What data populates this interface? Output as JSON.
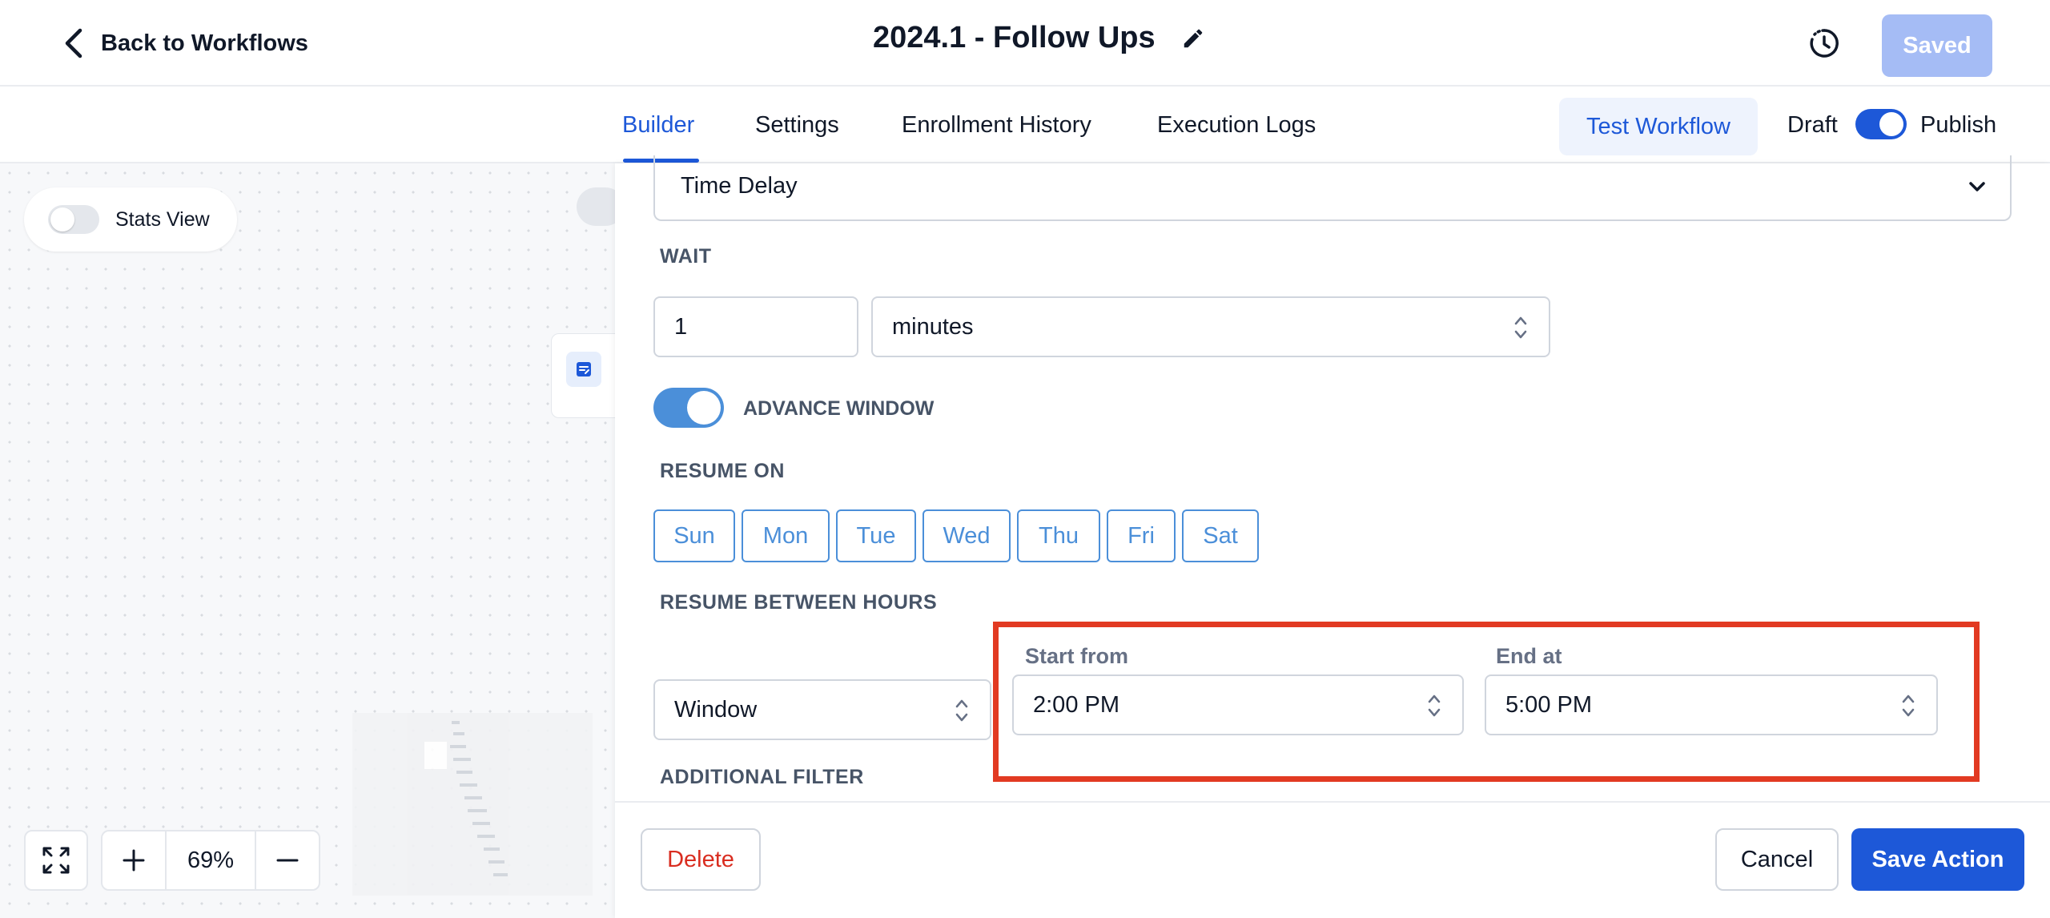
{
  "header": {
    "back_label": "Back to Workflows",
    "title": "2024.1 - Follow Ups",
    "saved_label": "Saved"
  },
  "tabs": [
    {
      "label": "Builder",
      "active": true
    },
    {
      "label": "Settings",
      "active": false
    },
    {
      "label": "Enrollment History",
      "active": false
    },
    {
      "label": "Execution Logs",
      "active": false
    }
  ],
  "toolbar": {
    "test_label": "Test Workflow",
    "draft_label": "Draft",
    "publish_label": "Publish",
    "publish_on": true
  },
  "canvas": {
    "stats_label": "Stats View",
    "stats_on": false,
    "zoom": "69%"
  },
  "action": {
    "type_value": "Time Delay",
    "wait_label": "WAIT",
    "wait_amount": "1",
    "wait_unit": "minutes",
    "advance_window_label": "ADVANCE WINDOW",
    "advance_window_on": true,
    "resume_on_label": "RESUME ON",
    "days": [
      "Sun",
      "Mon",
      "Tue",
      "Wed",
      "Thu",
      "Fri",
      "Sat"
    ],
    "resume_hours_label": "RESUME BETWEEN HOURS",
    "window_value": "Window",
    "start_label": "Start from",
    "start_value": "2:00 PM",
    "end_label": "End at",
    "end_value": "5:00 PM",
    "additional_filter_label": "ADDITIONAL FILTER"
  },
  "footer": {
    "delete_label": "Delete",
    "cancel_label": "Cancel",
    "save_label": "Save Action"
  },
  "colors": {
    "primary": "#1d58d8",
    "day_outline": "#4b8fd9",
    "highlight": "#e23a22",
    "danger": "#d92d20"
  }
}
